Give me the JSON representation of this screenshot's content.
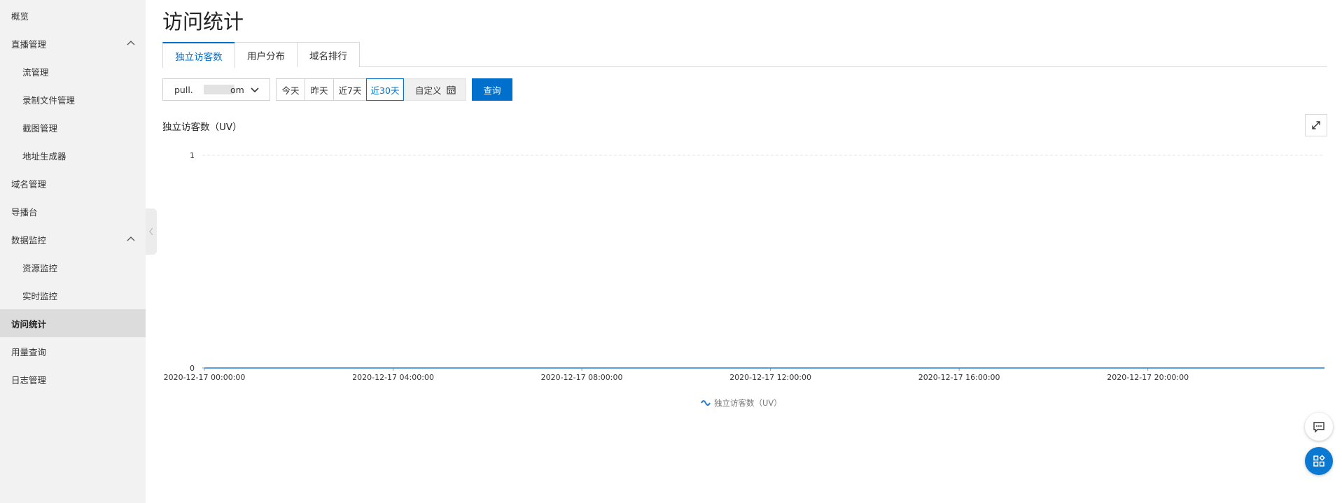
{
  "sidebar": {
    "items": [
      {
        "label": "概览"
      },
      {
        "label": "直播管理"
      },
      {
        "label": "流管理"
      },
      {
        "label": "录制文件管理"
      },
      {
        "label": "截图管理"
      },
      {
        "label": "地址生成器"
      },
      {
        "label": "域名管理"
      },
      {
        "label": "导播台"
      },
      {
        "label": "数据监控"
      },
      {
        "label": "资源监控"
      },
      {
        "label": "实时监控"
      },
      {
        "label": "访问统计"
      },
      {
        "label": "用量查询"
      },
      {
        "label": "日志管理"
      }
    ]
  },
  "page": {
    "title": "访问统计"
  },
  "tabs": [
    {
      "label": "独立访客数"
    },
    {
      "label": "用户分布"
    },
    {
      "label": "域名排行"
    }
  ],
  "toolbar": {
    "domain_prefix": "pull.",
    "domain_suffix": "om",
    "ranges": [
      {
        "label": "今天"
      },
      {
        "label": "昨天"
      },
      {
        "label": "近7天"
      },
      {
        "label": "近30天"
      }
    ],
    "custom_label": "自定义",
    "query_label": "查询"
  },
  "colors": {
    "accent": "#0070cc",
    "series": "#1f7fd6"
  },
  "chart_data": {
    "type": "line",
    "title": "独立访客数（UV）",
    "x": [
      "2020-12-17 00:00:00",
      "2020-12-17 04:00:00",
      "2020-12-17 08:00:00",
      "2020-12-17 12:00:00",
      "2020-12-17 16:00:00",
      "2020-12-17 20:00:00"
    ],
    "x_ticks": [
      "2020-12-17 00:00:00",
      "2020-12-17 04:00:00",
      "2020-12-17 08:00:00",
      "2020-12-17 12:00:00",
      "2020-12-17 16:00:00",
      "2020-12-17 20:00:00"
    ],
    "y_ticks": [
      "1",
      "0"
    ],
    "ylim": [
      0,
      1
    ],
    "series": [
      {
        "name": "独立访客数（UV）",
        "values": [
          0,
          0,
          0,
          0,
          0,
          0
        ]
      }
    ],
    "grid": true,
    "legend": "bottom"
  },
  "icons": {
    "collapse": "chevron-left-icon",
    "fullscreen": "expand-icon",
    "feedback": "chat-icon",
    "apps": "apps-icon",
    "calendar": "calendar-icon"
  }
}
